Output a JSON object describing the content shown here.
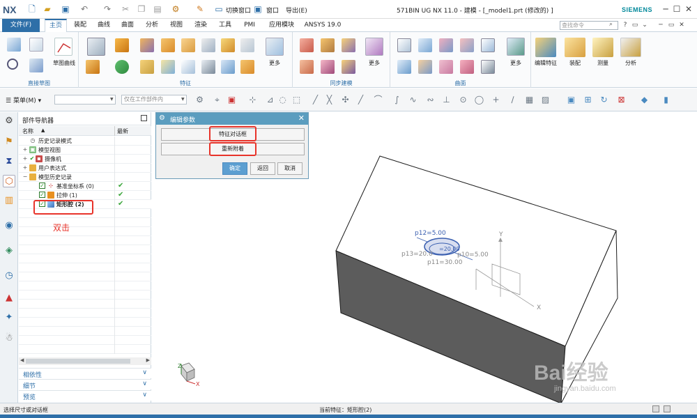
{
  "app": {
    "logo": "NX",
    "title": "571BIN UG NX 11.0 - 建模 - [_model1.prt  (修改的)  ]",
    "brand": "SIEMENS",
    "switch_window": "切换窗口",
    "window_menu": "窗口",
    "export_menu": "导出(E)"
  },
  "menu": {
    "file": "文件(F)",
    "tabs": [
      "主页",
      "装配",
      "曲线",
      "曲面",
      "分析",
      "视图",
      "渲染",
      "工具",
      "PMI",
      "应用模块",
      "ANSYS 19.0"
    ],
    "active_tab": "主页",
    "search_placeholder": "查找命令"
  },
  "ribbon": {
    "groups": [
      {
        "label": "直接草图",
        "captions": [
          "草图曲线"
        ]
      },
      {
        "label": "特征",
        "captions": [
          "更多"
        ]
      },
      {
        "label": "同步建模",
        "captions": [
          "更多"
        ]
      },
      {
        "label": "曲面",
        "captions": [
          "更多"
        ]
      },
      {
        "label": "",
        "captions": [
          "编辑特征",
          "装配",
          "测量",
          "分析"
        ]
      }
    ]
  },
  "toolbar2": {
    "menu_button": "菜单(M)",
    "combo1": "",
    "combo2": "仅在工作部件内"
  },
  "navigator": {
    "title": "部件导航器",
    "col_name": "名称",
    "col_latest": "最新",
    "items": [
      {
        "label": "历史记录模式",
        "latest": ""
      },
      {
        "label": "模型视图",
        "latest": ""
      },
      {
        "label": "摄像机",
        "latest": ""
      },
      {
        "label": "用户表达式",
        "latest": ""
      },
      {
        "label": "模型历史记录",
        "latest": ""
      },
      {
        "label": "基准坐标系 (0)",
        "latest": "✔"
      },
      {
        "label": "拉伸 (1)",
        "latest": "✔"
      },
      {
        "label": "矩形腔 (2)",
        "latest": "✔"
      }
    ],
    "annotation": "双击",
    "panels": [
      "相依性",
      "细节",
      "预览"
    ]
  },
  "dialog": {
    "title": "编辑参数",
    "feature_dialog": "特征对话框",
    "reattach": "重新附着",
    "ok": "确定",
    "back": "返回",
    "cancel": "取消"
  },
  "viewport": {
    "labels": {
      "p12": "p12=5.00",
      "p_partial": "=20.00",
      "p10": "p10=5.00",
      "p13": "p13=20.0",
      "p11": "p11=30.00"
    },
    "axes": {
      "y": "Y",
      "x": "X",
      "z": "Z"
    }
  },
  "status": {
    "left": "选择尺寸或对话框",
    "current_feature": "当前特征：矩形腔(2)"
  },
  "watermark": {
    "brand": "Bai经验",
    "url": "jingyan.baidu.com"
  },
  "colors": {
    "accent": "#2e6fa8",
    "highlight": "#e8332a",
    "dialog_title": "#5b9dbf",
    "model_dark": "#5c5c5c",
    "dimension_blue": "#3a5fb0"
  }
}
